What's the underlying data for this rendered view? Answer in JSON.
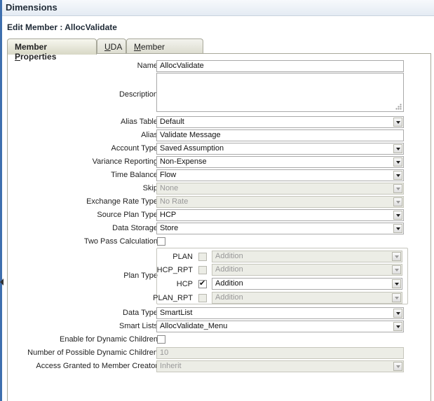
{
  "header": {
    "title": "Dimensions"
  },
  "page": {
    "edit_title": "Edit Member : AllocValidate"
  },
  "tabs": [
    {
      "label_pre": "Member ",
      "label_u": "P",
      "label_post": "roperties",
      "active": true
    },
    {
      "label_pre": "",
      "label_u": "U",
      "label_post": "DA",
      "active": false
    },
    {
      "label_pre": "",
      "label_u": "M",
      "label_post": "ember Formula",
      "active": false
    }
  ],
  "fields": {
    "name": {
      "label": "Name",
      "value": "AllocValidate"
    },
    "description": {
      "label": "Description",
      "value": ""
    },
    "alias_table": {
      "label": "Alias Table",
      "value": "Default"
    },
    "alias": {
      "label": "Alias",
      "value": "Validate Message"
    },
    "account_type": {
      "label": "Account Type",
      "value": "Saved Assumption"
    },
    "variance_reporting": {
      "label": "Variance Reporting",
      "value": "Non-Expense"
    },
    "time_balance": {
      "label": "Time Balance",
      "value": "Flow"
    },
    "skip": {
      "label": "Skip",
      "value": "None"
    },
    "exchange_rate_type": {
      "label": "Exchange Rate Type",
      "value": "No Rate"
    },
    "source_plan_type": {
      "label": "Source Plan Type",
      "value": "HCP"
    },
    "data_storage": {
      "label": "Data Storage",
      "value": "Store"
    },
    "two_pass": {
      "label": "Two Pass Calculation",
      "checked": false
    },
    "plan_type": {
      "label": "Plan Type"
    },
    "data_type": {
      "label": "Data Type",
      "value": "SmartList"
    },
    "smart_lists": {
      "label": "Smart Lists",
      "value": "AllocValidate_Menu"
    },
    "dynamic_children": {
      "label": "Enable for Dynamic Children",
      "checked": false
    },
    "num_dynamic_children": {
      "label": "Number of Possible Dynamic Children",
      "value": "10"
    },
    "access_granted": {
      "label": "Access Granted to Member Creator",
      "value": "Inherit"
    }
  },
  "plan_types": [
    {
      "name": "PLAN",
      "checked": false,
      "enabled": false,
      "consolidation": "Addition"
    },
    {
      "name": "HCP_RPT",
      "checked": false,
      "enabled": false,
      "consolidation": "Addition"
    },
    {
      "name": "HCP",
      "checked": true,
      "enabled": true,
      "consolidation": "Addition"
    },
    {
      "name": "PLAN_RPT",
      "checked": false,
      "enabled": false,
      "consolidation": "Addition"
    }
  ],
  "icons": {
    "dropdown": "chevron-down-icon",
    "collapse": "arrow-left-icon",
    "resize": "resize-grip-icon"
  },
  "colors": {
    "accent": "#3e6fae",
    "disabled_bg": "#ecede6"
  }
}
